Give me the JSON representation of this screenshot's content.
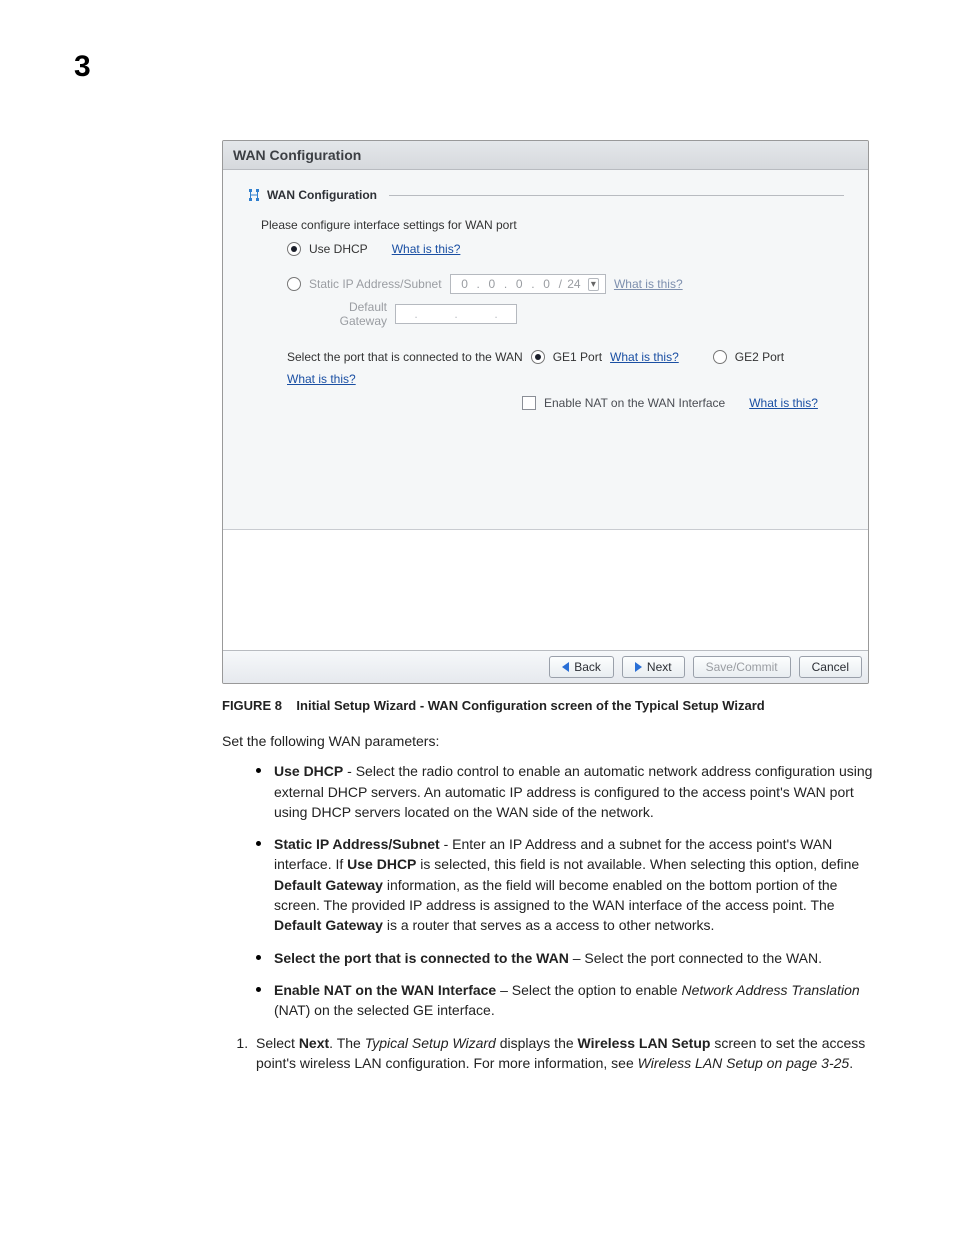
{
  "chapter_number": "3",
  "screenshot": {
    "titlebar": "WAN Configuration",
    "legend": "WAN Configuration",
    "instruction": "Please configure interface settings for WAN port",
    "use_dhcp_label": "Use DHCP",
    "what_is_this": "What is this?",
    "static_ip_label": "Static IP Address/Subnet",
    "ip_octet": "0",
    "ip_sep": ".",
    "ip_slash": "/",
    "ip_prefix": "24",
    "default_gateway_label": "Default Gateway",
    "port_select_label": "Select the port that is connected to the WAN",
    "ge1_label": "GE1 Port",
    "ge2_label": "GE2 Port",
    "nat_label": "Enable NAT on the WAN Interface",
    "buttons": {
      "back": "Back",
      "next": "Next",
      "save": "Save/Commit",
      "cancel": "Cancel"
    }
  },
  "caption": {
    "label": "FIGURE 8",
    "text": "Initial Setup Wizard - WAN Configuration screen of the Typical Setup Wizard"
  },
  "intro": "Set the following WAN parameters:",
  "bullets": {
    "dhcp_b": "Use DHCP",
    "dhcp_t": " - Select the radio control to enable an automatic network address configuration using external DHCP servers. An automatic IP address is configured to the access point's WAN port using DHCP servers located on the WAN side of the network.",
    "static_b": "Static IP Address/Subnet",
    "static_t1": " - Enter an IP Address and a subnet for the access point's WAN interface. If ",
    "static_b2": "Use DHCP",
    "static_t2": " is selected, this field is not available. When selecting this option, define ",
    "static_b3": "Default Gateway",
    "static_t3": " information, as the field will become enabled on the bottom portion of the screen. The provided IP address is assigned to the WAN interface of the access point. The ",
    "static_b4": "Default Gateway",
    "static_t4": " is a router that serves as a access to other networks.",
    "port_b": "Select the port that is connected to the WAN",
    "port_t": " – Select the port connected to the WAN.",
    "nat_b": "Enable NAT on the WAN Interface",
    "nat_t1": " – Select the option to enable ",
    "nat_i": "Network Address Translation",
    "nat_t2": " (NAT) on the selected GE interface."
  },
  "step": {
    "pre": "Select ",
    "next_b": "Next",
    "t1": ". The ",
    "tsw_i": "Typical Setup Wizard",
    "t2": " displays the ",
    "wls_b": "Wireless LAN Setup",
    "t3": " screen to set the access point's wireless LAN configuration. For more information, see ",
    "ref_i": "Wireless LAN Setup on page 3-25",
    "t4": "."
  }
}
